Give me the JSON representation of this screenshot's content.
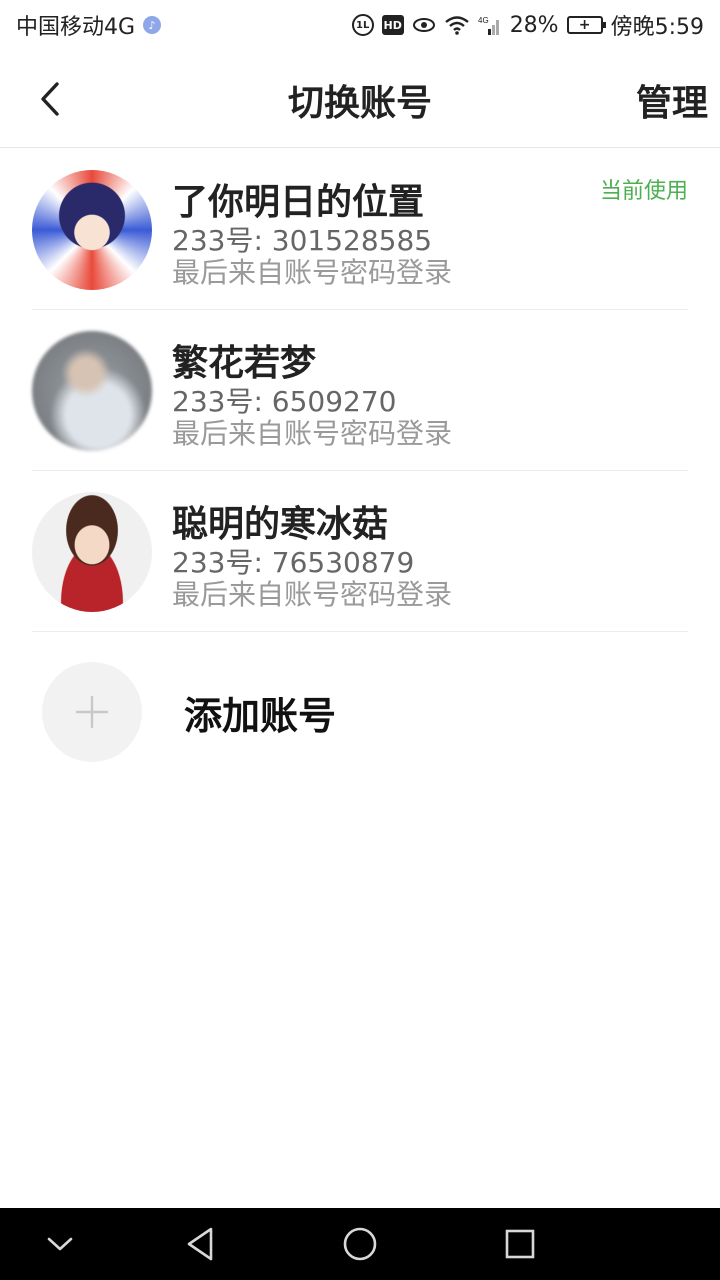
{
  "status_bar": {
    "carrier": "中国移动4G",
    "carrier_badge_icon": "music-badge-icon",
    "mini_icon_text": "1L",
    "hd_text": "HD",
    "network_type": "4G",
    "battery_percent": "28%",
    "time": "傍晚5:59"
  },
  "header": {
    "back_icon": "chevron-left-icon",
    "title": "切换账号",
    "manage_label": "管理"
  },
  "accounts": [
    {
      "name": "了你明日的位置",
      "id_text": "233号: 301528585",
      "login_text": "最后来自账号密码登录",
      "badge": "当前使用"
    },
    {
      "name": "繁花若梦",
      "id_text": "233号: 6509270",
      "login_text": "最后来自账号密码登录"
    },
    {
      "name": "聪明的寒冰菇",
      "id_text": "233号: 76530879",
      "login_text": "最后来自账号密码登录"
    }
  ],
  "add_account": {
    "icon": "plus-icon",
    "label": "添加账号"
  },
  "colors": {
    "accent_green": "#4caf50",
    "title_text": "#222222",
    "secondary_text": "#9a9a9a"
  }
}
